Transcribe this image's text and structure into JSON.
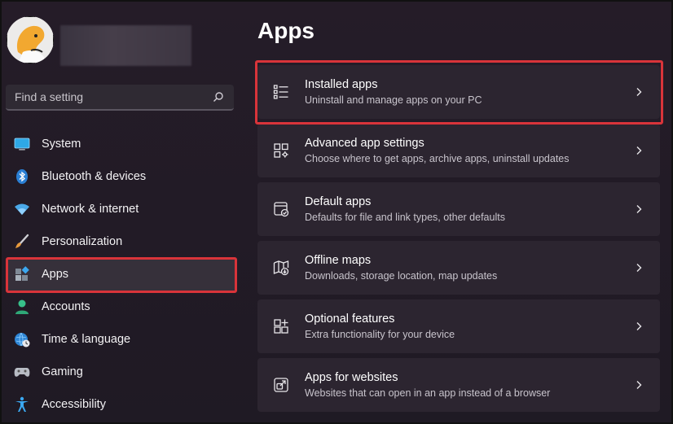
{
  "search": {
    "placeholder": "Find a setting"
  },
  "sidebar": {
    "items": [
      {
        "label": "System",
        "icon": "monitor-icon"
      },
      {
        "label": "Bluetooth & devices",
        "icon": "bluetooth-icon"
      },
      {
        "label": "Network & internet",
        "icon": "wifi-icon"
      },
      {
        "label": "Personalization",
        "icon": "brush-icon"
      },
      {
        "label": "Apps",
        "icon": "apps-icon",
        "selected": true
      },
      {
        "label": "Accounts",
        "icon": "person-icon"
      },
      {
        "label": "Time & language",
        "icon": "globe-clock-icon"
      },
      {
        "label": "Gaming",
        "icon": "gamepad-icon"
      },
      {
        "label": "Accessibility",
        "icon": "accessibility-icon"
      }
    ]
  },
  "main": {
    "title": "Apps",
    "cards": [
      {
        "title": "Installed apps",
        "subtitle": "Uninstall and manage apps on your PC",
        "icon": "list-icon"
      },
      {
        "title": "Advanced app settings",
        "subtitle": "Choose where to get apps, archive apps, uninstall updates",
        "icon": "app-settings-icon"
      },
      {
        "title": "Default apps",
        "subtitle": "Defaults for file and link types, other defaults",
        "icon": "default-apps-icon"
      },
      {
        "title": "Offline maps",
        "subtitle": "Downloads, storage location, map updates",
        "icon": "map-icon"
      },
      {
        "title": "Optional features",
        "subtitle": "Extra functionality for your device",
        "icon": "optional-features-icon"
      },
      {
        "title": "Apps for websites",
        "subtitle": "Websites that can open in an app instead of a browser",
        "icon": "open-external-icon"
      }
    ]
  },
  "colors": {
    "accent": "#4cc2ff",
    "highlight": "#d9343a",
    "card": "#2c2530",
    "background": "#201a24"
  }
}
